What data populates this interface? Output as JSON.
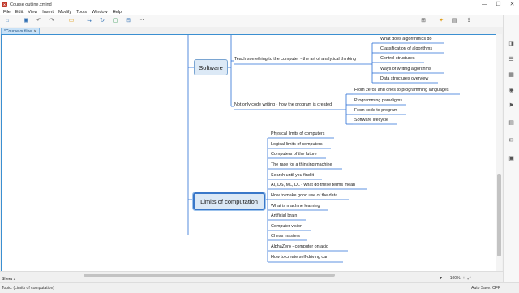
{
  "window": {
    "title": "Course outline.xmind",
    "app_icon": "xmind-logo-icon",
    "controls": [
      "—",
      "☐",
      "✕"
    ]
  },
  "menu": [
    "File",
    "Edit",
    "View",
    "Insert",
    "Modify",
    "Tools",
    "Window",
    "Help"
  ],
  "tab": {
    "label": "*Course outline",
    "close": "✕"
  },
  "toolbar_icons": [
    "home-icon",
    "save-icon",
    "undo-icon",
    "redo-icon",
    "topic-icon",
    "subtopic-icon",
    "relationship-icon",
    "boundary-icon",
    "summary-icon",
    "more-icon",
    "layout-icon",
    "idea-icon",
    "pitch-icon",
    "share-icon"
  ],
  "mindmap": {
    "topics": [
      {
        "label": "Software",
        "children": [
          {
            "label": "Teach something to the computer - the art of analytical thinking",
            "children": [
              "What does algorithmics do",
              "Classification of algorithms",
              "Control structures",
              "Ways of writing algorithms",
              "Data structures overview"
            ]
          },
          {
            "label": "Not only code writing - how the program is created",
            "children": [
              "From zeros and ones to programming languages",
              "Programming paradigms",
              "From code to program",
              "Software lifecycle"
            ]
          }
        ]
      },
      {
        "label": "Limits of computation",
        "children": [
          "Physical limits of computers",
          "Logical limits of computers",
          "Computers of the future",
          "The race for a thinking machine",
          "Search until you find it",
          "AI, DS, ML, DL - what do these terms mean",
          "How to make good use of the data",
          "What is machine learning",
          "Artificial brain",
          "Computer vision",
          "Chess masters",
          "AlphaZero - computer on acid",
          "How to create self-driving car"
        ]
      }
    ]
  },
  "sheet": {
    "label": "Sheet 1"
  },
  "zoom": {
    "value": "100%",
    "minus": "–",
    "plus": "+"
  },
  "status": {
    "left": "Topic: (Limits of computation)",
    "right": "Auto Save: OFF"
  },
  "colors": {
    "accent": "#3b8fd1",
    "branch": "#2a6fd6",
    "node_fill": "#dce9f6"
  }
}
